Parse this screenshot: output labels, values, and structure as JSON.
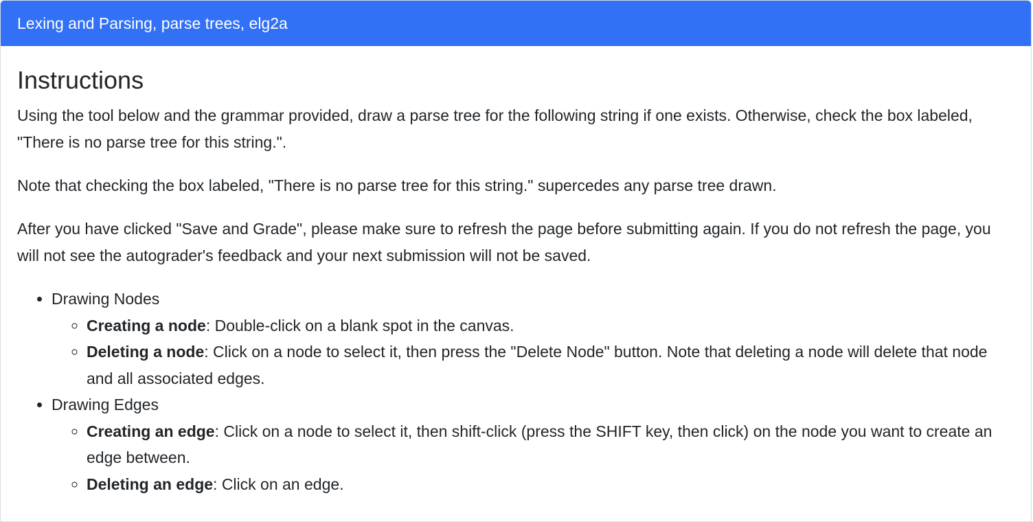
{
  "header": {
    "title": "Lexing and Parsing, parse trees, elg2a"
  },
  "instructions": {
    "heading": "Instructions",
    "paragraphs": [
      "Using the tool below and the grammar provided, draw a parse tree for the following string if one exists. Otherwise, check the box labeled, \"There is no parse tree for this string.\".",
      "Note that checking the box labeled, \"There is no parse tree for this string.\" supercedes any parse tree drawn.",
      "After you have clicked \"Save and Grade\", please make sure to refresh the page before submitting again. If you do not refresh the page, you will not see the autograder's feedback and your next submission will not be saved."
    ],
    "sections": [
      {
        "title": "Drawing Nodes",
        "items": [
          {
            "term": "Creating a node",
            "desc": ": Double-click on a blank spot in the canvas."
          },
          {
            "term": "Deleting a node",
            "desc": ": Click on a node to select it, then press the \"Delete Node\" button. Note that deleting a node will delete that node and all associated edges."
          }
        ]
      },
      {
        "title": "Drawing Edges",
        "items": [
          {
            "term": "Creating an edge",
            "desc": ": Click on a node to select it, then shift-click (press the SHIFT key, then click) on the node you want to create an edge between."
          },
          {
            "term": "Deleting an edge",
            "desc": ": Click on an edge."
          }
        ]
      }
    ]
  }
}
